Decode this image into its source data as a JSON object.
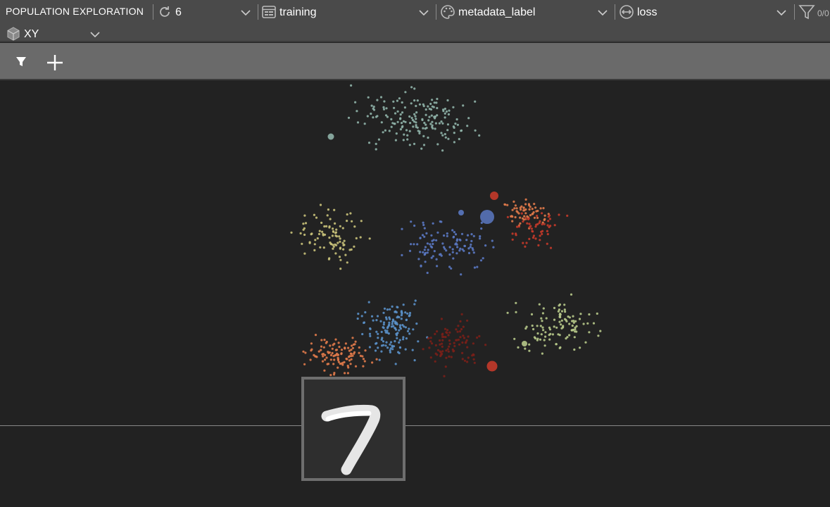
{
  "header": {
    "title": "POPULATION EXPLORATION",
    "dropdowns": {
      "epoch": {
        "value": "6",
        "icon": "refresh-icon"
      },
      "dataset": {
        "value": "training",
        "icon": "dataset-icon"
      },
      "color_by": {
        "value": "metadata_label",
        "icon": "palette-icon"
      },
      "size_by": {
        "value": "loss",
        "icon": "resize-icon"
      },
      "projection": {
        "value": "XY",
        "icon": "cube-icon"
      }
    },
    "filter_count": "0/0"
  },
  "toolbar": {
    "filter_icon": "filter-icon",
    "add_icon": "plus-icon"
  },
  "colors": {
    "header_bg": "#4a4a4a",
    "toolbar_bg": "#6a6a6a",
    "plot_bg": "#222222"
  },
  "hovered_sample": {
    "digit_depicted": "7"
  },
  "chart_data": {
    "type": "scatter",
    "title": "",
    "xlabel": "",
    "ylabel": "",
    "legend": "none",
    "grid": false,
    "series": [
      {
        "color": "#8fb3a8",
        "values": []
      },
      {
        "color": "#c9c27a",
        "values": []
      },
      {
        "color": "#5a78c2",
        "values": []
      },
      {
        "color": "#c43a2a",
        "values": []
      },
      {
        "color": "#e07a4a",
        "values": []
      },
      {
        "color": "#5a90c8",
        "values": []
      },
      {
        "color": "#7a1f18",
        "values": []
      },
      {
        "color": "#b7c98a",
        "values": []
      }
    ]
  }
}
